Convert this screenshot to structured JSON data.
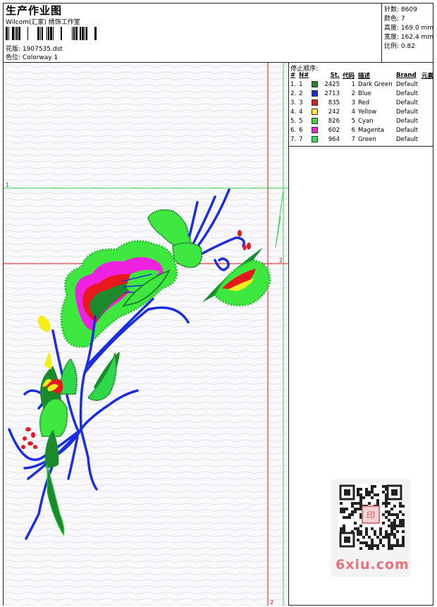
{
  "header": {
    "title": "生产作业图",
    "company": "Wilcom(汇家) 绣饰工作室",
    "file_label": "花版:",
    "file_name": "1907535.dst",
    "color_label": "色位:",
    "colorway": "Colorway 1"
  },
  "stats": [
    {
      "label": "针数:",
      "value": "8609"
    },
    {
      "label": "颜色:",
      "value": "7"
    },
    {
      "label": "高度:",
      "value": "169.0 mm"
    },
    {
      "label": "宽度:",
      "value": "162.4 mm"
    },
    {
      "label": "比例:",
      "value": "0.82"
    }
  ],
  "stop_sequence": {
    "title": "停止顺序:",
    "columns": [
      "#",
      "N#",
      "St.",
      "代码",
      "描述",
      "Brand",
      "元素"
    ],
    "rows": [
      {
        "index": "1.",
        "needle": "1",
        "color": "#1a8a2a",
        "stitches": "2425",
        "code": "1",
        "description": "Dark Green",
        "brand": "Default"
      },
      {
        "index": "2.",
        "needle": "2",
        "color": "#1a2ee0",
        "stitches": "2713",
        "code": "2",
        "description": "Blue",
        "brand": "Default"
      },
      {
        "index": "3.",
        "needle": "3",
        "color": "#e8181c",
        "stitches": "835",
        "code": "3",
        "description": "Red",
        "brand": "Default"
      },
      {
        "index": "4.",
        "needle": "4",
        "color": "#f5ee1a",
        "stitches": "242",
        "code": "4",
        "description": "Yellow",
        "brand": "Default"
      },
      {
        "index": "5.",
        "needle": "5",
        "color": "#44d43f",
        "stitches": "826",
        "code": "5",
        "description": "Cyan",
        "brand": "Default"
      },
      {
        "index": "6.",
        "needle": "6",
        "color": "#ee22e0",
        "stitches": "602",
        "code": "6",
        "description": "Magenta",
        "brand": "Default"
      },
      {
        "index": "7.",
        "needle": "7",
        "color": "#2ee85a",
        "stitches": "964",
        "code": "7",
        "description": "Green",
        "brand": "Default"
      }
    ]
  },
  "guides": {
    "green_label": "1",
    "red_label_right": "2",
    "red_label_bottom": "2"
  },
  "watermark": {
    "text": "6xiu.com",
    "stamp": "印"
  }
}
